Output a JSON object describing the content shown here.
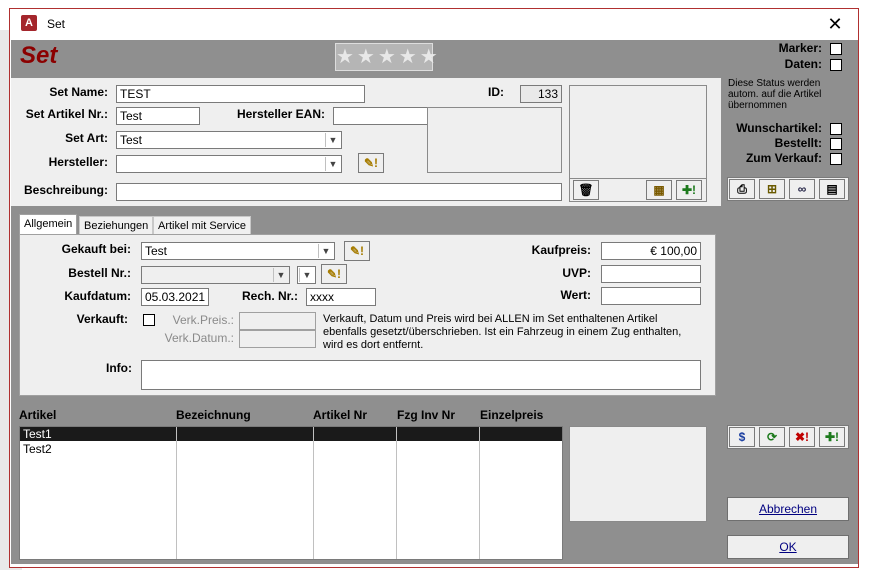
{
  "window": {
    "title": "Set",
    "app_icon": "A",
    "close_glyph": "✕"
  },
  "form": {
    "title": "Set",
    "rating": "★★★★★"
  },
  "fields": {
    "set_name_label": "Set Name:",
    "set_name_value": "TEST",
    "id_label": "ID:",
    "id_value": "133",
    "set_artikel_label": "Set Artikel Nr.:",
    "set_artikel_value": "Test",
    "hersteller_ean_label": "Hersteller EAN:",
    "hersteller_ean_value": "",
    "set_art_label": "Set Art:",
    "set_art_value": "Test",
    "hersteller_label": "Hersteller:",
    "hersteller_value": "",
    "beschreibung_label": "Beschreibung:",
    "beschreibung_value": ""
  },
  "status": {
    "marker_label": "Marker:",
    "daten_label": "Daten:",
    "note": "Diese Status werden autom. auf die Artikel übernommen",
    "wunschartikel_label": "Wunschartikel:",
    "bestellt_label": "Bestellt:",
    "zum_verkauf_label": "Zum Verkauf:"
  },
  "tabs": [
    "Allgemein",
    "Beziehungen",
    "Artikel mit Service"
  ],
  "allgemein": {
    "gekauft_bei_label": "Gekauft bei:",
    "gekauft_bei_value": "Test",
    "bestell_nr_label": "Bestell Nr.:",
    "bestell_nr_value": "",
    "kaufdatum_label": "Kaufdatum:",
    "kaufdatum_value": "05.03.2021",
    "rech_nr_label": "Rech. Nr.:",
    "rech_nr_value": "xxxx",
    "verkauft_label": "Verkauft:",
    "verk_preis_label": "Verk.Preis.:",
    "verk_datum_label": "Verk.Datum.:",
    "verkauft_note": "Verkauft, Datum und Preis wird bei ALLEN im Set enthaltenen Artikel ebenfalls gesetzt/überschrieben. Ist ein Fahrzeug in einem Zug enthalten, wird es dort entfernt.",
    "kaufpreis_label": "Kaufpreis:",
    "kaufpreis_value": "€ 100,00",
    "uvp_label": "UVP:",
    "uvp_value": "",
    "wert_label": "Wert:",
    "wert_value": "",
    "info_label": "Info:",
    "info_value": ""
  },
  "table": {
    "columns": [
      "Artikel",
      "Bezeichnung",
      "Artikel Nr",
      "Fzg Inv Nr",
      "Einzelpreis"
    ],
    "rows": [
      [
        "Test1",
        "",
        "",
        "",
        ""
      ],
      [
        "Test2",
        "",
        "",
        "",
        ""
      ]
    ]
  },
  "buttons": {
    "abbrechen": "Abbrechen",
    "ok": "OK"
  },
  "icons": {
    "trash": "🗑",
    "new_image": "▦",
    "add": "✚!",
    "edit_pen": "✎!",
    "print": "⎙",
    "tree": "⊞",
    "glasses": "∞",
    "table": "▤",
    "dollar": "$",
    "refresh": "⟳",
    "delete": "✖!"
  }
}
